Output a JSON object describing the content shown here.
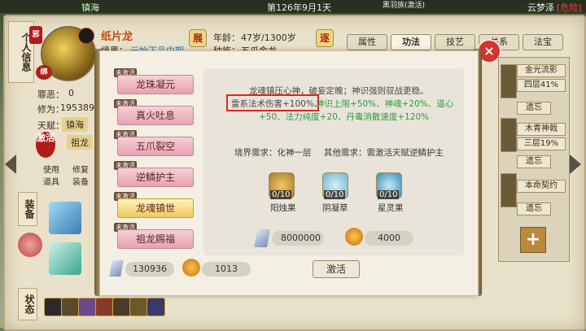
{
  "top_bar": {
    "date": "第126年9月1天",
    "left_fragment": "镇海",
    "center_fragment": "黑羽族(激活)",
    "location": "云梦泽",
    "danger": "[危险]"
  },
  "sidebar": {
    "tab_personal": "个人信息",
    "tab_equip": "装备",
    "tab_status": "状态",
    "use_item": "使用道具",
    "repair": "修复装备"
  },
  "character": {
    "seal_top": "邪",
    "seal_mid": "绑",
    "name": "纸片龙",
    "realm_label": "境界：",
    "realm_value": "元始下品中期",
    "age_label": "年龄：",
    "age_value": "47岁/1300岁",
    "race_label": "种族：",
    "race_value": "五爪金龙",
    "sin_label": "罪恶：",
    "sin_value": "0",
    "cultivation_label": "修为：",
    "cultivation_value": "195389",
    "talent_label": "天赋：",
    "talents": [
      "镇海",
      "祖龙",
      "激活"
    ],
    "btn_zhan": "展",
    "btn_yi": "逐"
  },
  "tabs": [
    "属性",
    "功法",
    "技艺",
    "关系",
    "法宝"
  ],
  "active_tab": "功法",
  "skills": [
    {
      "name": "龙珠凝元",
      "badge": "未激活"
    },
    {
      "name": "真火吐息",
      "badge": "未激活"
    },
    {
      "name": "五爪裂空",
      "badge": "未激活"
    },
    {
      "name": "逆鳞护主",
      "badge": "未激活"
    },
    {
      "name": "龙魂镇世",
      "badge": "未激活"
    },
    {
      "name": "祖龙赐福",
      "badge": "未激活"
    }
  ],
  "detail": {
    "line1": "龙魂镇压心神，破妄定魄；神识强则驭战更稳。",
    "highlight": "雷系法术伤害+100%、",
    "line2_rest": "神识上限+50%、神魂+20%、道心",
    "line3": "+50、法力纯度+20、丹毒消散速度+120%",
    "realm_req": "境界需求：化神一层",
    "other_req": "其他需求：需激活天赋逆鳞护主",
    "materials": [
      {
        "name": "阳烛果",
        "count": "0/10"
      },
      {
        "name": "阴凝草",
        "count": "0/10"
      },
      {
        "name": "星灵果",
        "count": "0/10"
      }
    ],
    "cost_stone": "8000000",
    "cost_coin": "4000",
    "activate": "激活"
  },
  "currency": {
    "spirit_stone": "130936",
    "coin": "1013"
  },
  "right_panel": {
    "items": [
      "金光流影",
      "四层41%",
      "遗忘",
      "木青神戟",
      "三层19%",
      "遗忘",
      "本命契约",
      "遗忘"
    ],
    "plus": "+"
  },
  "colors": {
    "highlight_box": "#e02424",
    "green": "#2d9a3c",
    "close": "#d4362d"
  }
}
